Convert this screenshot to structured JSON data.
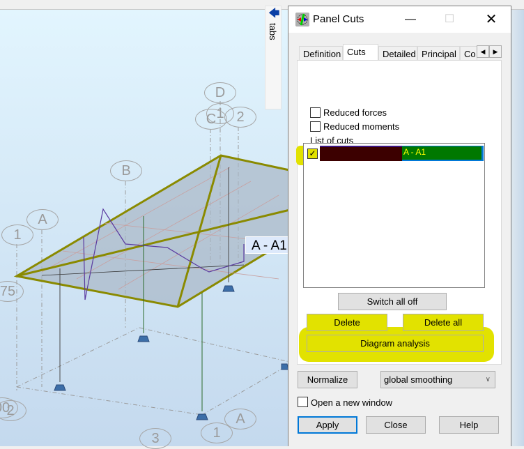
{
  "viewport": {
    "tabs_label": "tabs",
    "grid_labels": [
      "D",
      "1",
      "C",
      "2",
      "B",
      "A",
      "1",
      "75",
      "00",
      "2",
      "3",
      "1",
      "A"
    ],
    "cut_label": "A - A1"
  },
  "dialog": {
    "title": "Panel Cuts",
    "tabs": [
      {
        "label": "Definition",
        "active": false
      },
      {
        "label": "Cuts",
        "active": true
      },
      {
        "label": "Detailed",
        "active": false
      },
      {
        "label": "Principal",
        "active": false
      },
      {
        "label": "Co",
        "active": false
      }
    ],
    "reduced_forces": {
      "label": "Reduced forces",
      "checked": false
    },
    "reduced_moments": {
      "label": "Reduced moments",
      "checked": false
    },
    "list_label": "List of cuts",
    "cuts": [
      {
        "name": "A - A1",
        "checked": true
      }
    ],
    "switch_all_off": "Switch all off",
    "delete": "Delete",
    "delete_all": "Delete all",
    "diagram_analysis": "Diagram analysis",
    "normalize": "Normalize",
    "smoothing": "global smoothing",
    "open_new_window": {
      "label": "Open a new window",
      "checked": false
    },
    "apply": "Apply",
    "close": "Close",
    "help": "Help"
  },
  "colors": {
    "highlight": "#e2e200",
    "structure": "#8a8a00",
    "diagram": "#5a3aa0"
  }
}
